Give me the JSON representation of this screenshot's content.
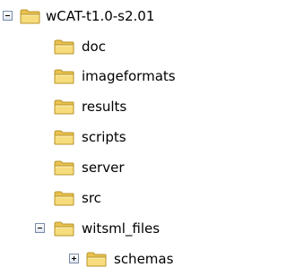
{
  "tree": {
    "root": {
      "label": "wCAT-t1.0-s2.01",
      "expanded": true,
      "icon": "folder-icon"
    },
    "children": [
      {
        "label": "doc",
        "icon": "folder-icon"
      },
      {
        "label": "imageformats",
        "icon": "folder-icon"
      },
      {
        "label": "results",
        "icon": "folder-icon"
      },
      {
        "label": "scripts",
        "icon": "folder-icon"
      },
      {
        "label": "server",
        "icon": "folder-icon"
      },
      {
        "label": "src",
        "icon": "folder-icon"
      },
      {
        "label": "witsml_files",
        "icon": "folder-icon",
        "expanded": true
      }
    ],
    "grandchildren": [
      {
        "label": "schemas",
        "icon": "folder-icon",
        "expanded": false
      }
    ]
  },
  "colors": {
    "folder_body": "#f3d36a",
    "folder_tab": "#e9c14f",
    "folder_outline": "#b8952a",
    "expander_border": "#7a8ba8"
  }
}
